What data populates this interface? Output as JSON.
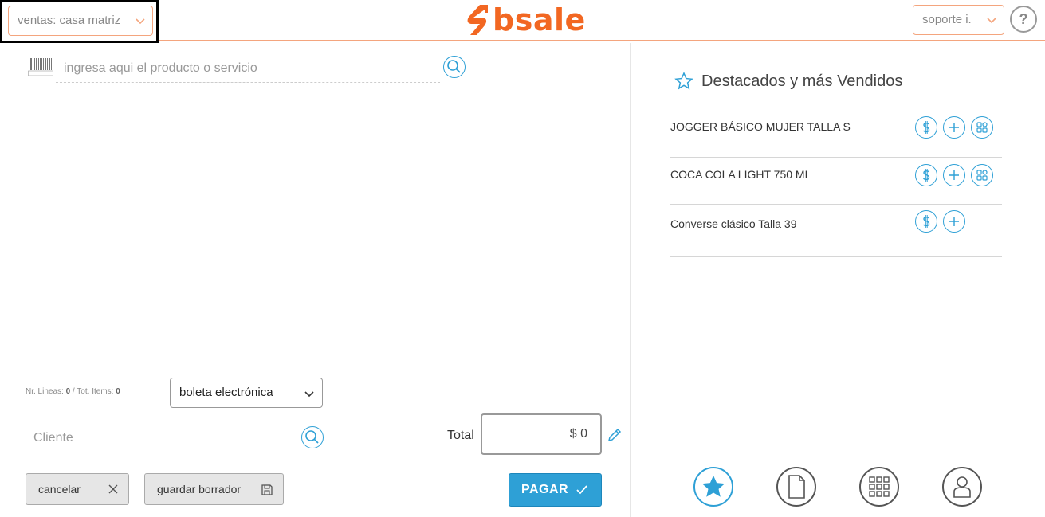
{
  "header": {
    "branch_select": "ventas: casa matriz",
    "logo_text": "bsale",
    "support_select": "soporte i.",
    "help_label": "?"
  },
  "sale": {
    "product_placeholder": "ingresa aqui el producto o servicio",
    "counts_prefix": "Nr. Lineas: ",
    "lines": "0",
    "counts_mid": " / Tot. Items: ",
    "items": "0",
    "document_type": "boleta electrónica",
    "client_placeholder": "Cliente",
    "total_label": "Total",
    "total_value": "$ 0",
    "cancel_label": "cancelar",
    "draft_label": "guardar borrador",
    "pay_label": "PAGAR"
  },
  "favorites": {
    "title": "Destacados y más Vendidos",
    "products": [
      {
        "name": "JOGGER BÁSICO MUJER TALLA S",
        "has_variants": true
      },
      {
        "name": "COCA COLA LIGHT 750 ML",
        "has_variants": true
      },
      {
        "name": "Converse clásico Talla 39",
        "has_variants": false
      }
    ]
  },
  "colors": {
    "accent": "#2ea0d6",
    "brand": "#f26722",
    "border_orange": "#f4a57e"
  }
}
